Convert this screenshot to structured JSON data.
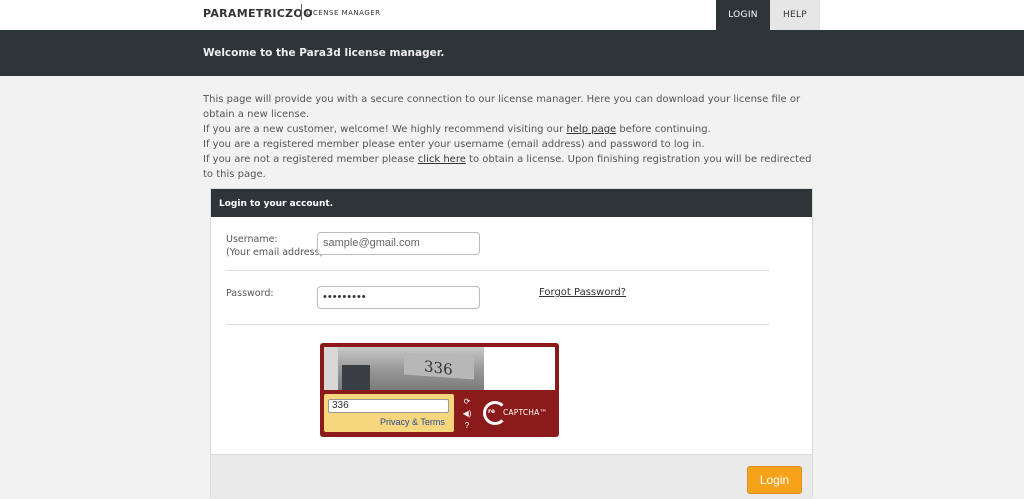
{
  "topbar": {
    "brand": "PARAMETRICZOO",
    "brand_sub": "LICENSE MANAGER",
    "nav": {
      "login": "LOGIN",
      "help": "HELP"
    }
  },
  "band": {
    "title": "Welcome to the Para3d license manager."
  },
  "intro": {
    "line1": "This page will provide you with a secure connection to our license manager. Here you can download your license file or obtain a new license.",
    "line2_pre": "If you are a new customer, welcome! We highly recommend visiting our ",
    "line2_link": "help page",
    "line2_post": " before continuing.",
    "line3": "If you are a registered member please enter your username (email address) and password to log in.",
    "line4_pre": "If you are not a registered member please ",
    "line4_link": "click here",
    "line4_post": " to obtain a license. Upon finishing registration you will be redirected to this page."
  },
  "panel": {
    "title": "Login to your account.",
    "username_label": "Username:",
    "username_hint": "(Your email address)",
    "username_value": "sample@gmail.com",
    "password_label": "Password:",
    "password_value": "•••••••••",
    "forgot_label": "Forgot Password?",
    "login_label": "Login"
  },
  "captcha": {
    "image_text": "336",
    "input_value": "336",
    "privacy_label": "Privacy & Terms",
    "logo_re": "re",
    "logo_word": "CAPTCHA™",
    "icons": [
      "refresh-icon",
      "audio-icon",
      "help-icon"
    ]
  }
}
